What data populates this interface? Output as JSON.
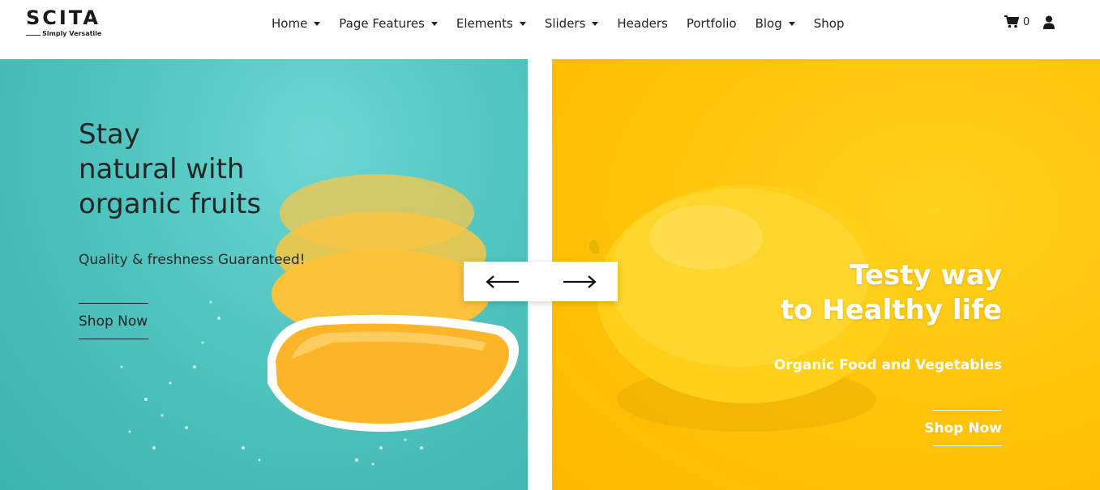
{
  "logo": {
    "main": "SCITA",
    "sub": "Simply Versatile"
  },
  "nav": [
    {
      "label": "Home",
      "dropdown": true
    },
    {
      "label": "Page Features",
      "dropdown": true
    },
    {
      "label": "Elements",
      "dropdown": true
    },
    {
      "label": "Sliders",
      "dropdown": true
    },
    {
      "label": "Headers",
      "dropdown": false
    },
    {
      "label": "Portfolio",
      "dropdown": false
    },
    {
      "label": "Blog",
      "dropdown": true
    },
    {
      "label": "Shop",
      "dropdown": false
    }
  ],
  "cart": {
    "count": "0",
    "icon": "shopping-cart-icon"
  },
  "user": {
    "icon": "user-icon"
  },
  "slides": {
    "left": {
      "title_1": "Stay",
      "title_2": "natural with",
      "title_3": "organic fruits",
      "description": "Quality & freshness Guaranteed!",
      "button": "Shop Now"
    },
    "right": {
      "title_1": "Testy way",
      "title_2": "to Healthy life",
      "description": "Organic Food and Vegetables",
      "button": "Shop Now"
    }
  },
  "slider_controls": {
    "prev_icon": "arrow-left-icon",
    "next_icon": "arrow-right-icon"
  },
  "colors": {
    "teal": "#50c4bf",
    "yellow": "#ffc40a",
    "text_dark": "#222222"
  }
}
